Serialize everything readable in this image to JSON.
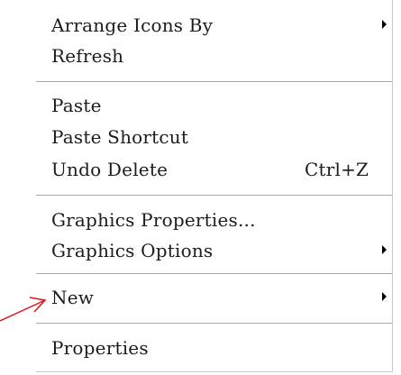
{
  "menu": {
    "items": [
      {
        "label": "Arrange Icons By",
        "shortcut": "",
        "submenu": true
      },
      {
        "label": "Refresh",
        "shortcut": "",
        "submenu": false
      },
      {
        "label": "Paste",
        "shortcut": "",
        "submenu": false
      },
      {
        "label": "Paste Shortcut",
        "shortcut": "",
        "submenu": false
      },
      {
        "label": "Undo Delete",
        "shortcut": "Ctrl+Z",
        "submenu": false
      },
      {
        "label": "Graphics Properties...",
        "shortcut": "",
        "submenu": false
      },
      {
        "label": "Graphics Options",
        "shortcut": "",
        "submenu": true
      },
      {
        "label": "New",
        "shortcut": "",
        "submenu": true
      },
      {
        "label": "Properties",
        "shortcut": "",
        "submenu": false
      }
    ]
  },
  "annotation": {
    "pointer_color": "#e0151b",
    "pointer_target": "New",
    "icon": "arrow-pointer-icon"
  }
}
